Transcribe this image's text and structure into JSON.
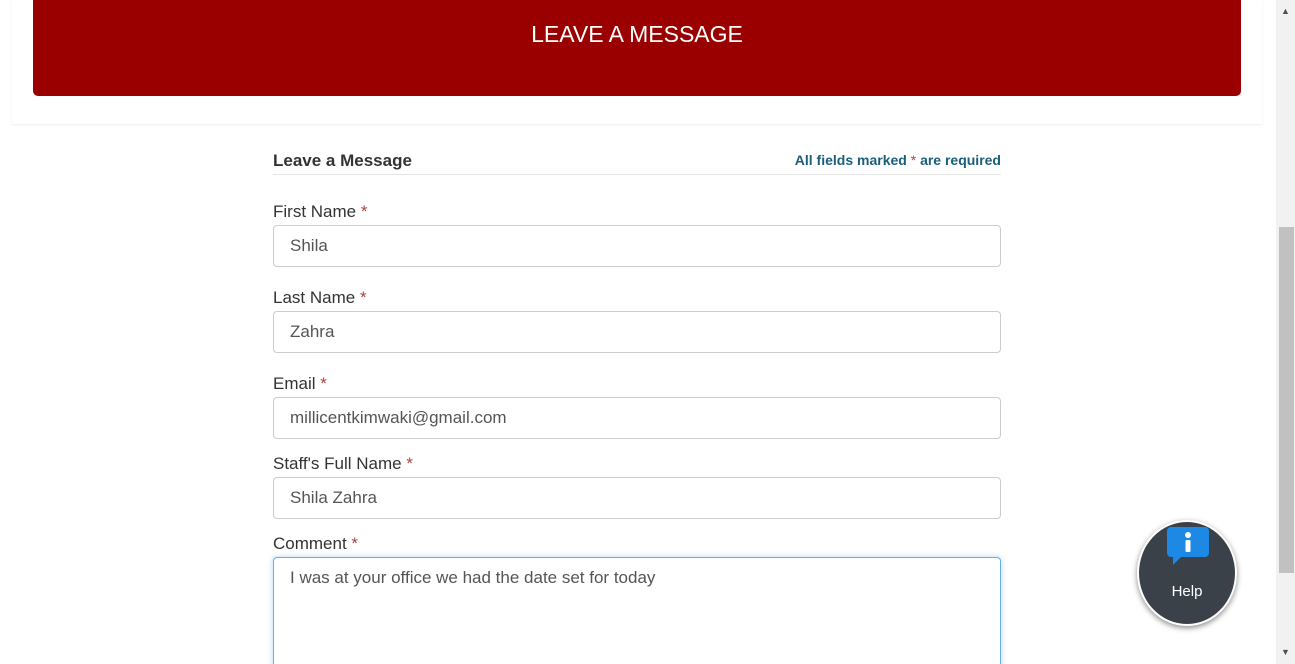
{
  "banner": {
    "title": "LEAVE A MESSAGE"
  },
  "form": {
    "title": "Leave a Message",
    "required_note_prefix": "All fields marked",
    "required_star": "*",
    "required_note_suffix": "are required",
    "fields": {
      "first_name": {
        "label": "First Name",
        "value": "Shila"
      },
      "last_name": {
        "label": "Last Name",
        "value": "Zahra"
      },
      "email": {
        "label": "Email",
        "value": "millicentkimwaki@gmail.com"
      },
      "staff_name": {
        "label": "Staff's Full Name",
        "value": "Shila Zahra"
      },
      "comment": {
        "label": "Comment",
        "value": "I was at your office we had the date set for today"
      }
    }
  },
  "help_widget": {
    "label": "Help",
    "icon": "info-chat-icon"
  },
  "colors": {
    "banner_bg": "#9b0000",
    "required_star": "#a94442",
    "required_note": "#1a5f7a",
    "help_bg": "#3a4148",
    "help_icon": "#1e88e5"
  }
}
